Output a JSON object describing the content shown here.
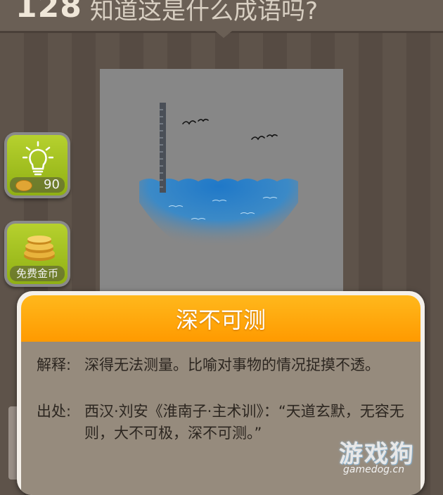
{
  "header": {
    "level_number": "128",
    "question": "知道这是什么成语吗?"
  },
  "hint_button": {
    "icon": "lightbulb-icon",
    "cost": "90"
  },
  "free_coins_button": {
    "icon": "coins-icon",
    "label": "免费金币"
  },
  "puzzle_image": {
    "depicts": [
      "ruler-icon",
      "birds-icon",
      "water-icon"
    ]
  },
  "answer_popup": {
    "title": "深不可测",
    "explanation_label": "解释:",
    "explanation_text": "深得无法测量。比喻对事物的情况捉摸不透。",
    "source_label": "出处:",
    "source_text": "西汉·刘安《淮南子·主术训》：“天道玄默，无容无则，大不可极，深不可测。”"
  },
  "watermark": {
    "text_cn": "游戏狗",
    "text_en": "gamedog.cn"
  },
  "colors": {
    "title_orange": "#ff9a00",
    "hint_green": "#9fbf1e",
    "panel_brown": "#968b7d"
  }
}
